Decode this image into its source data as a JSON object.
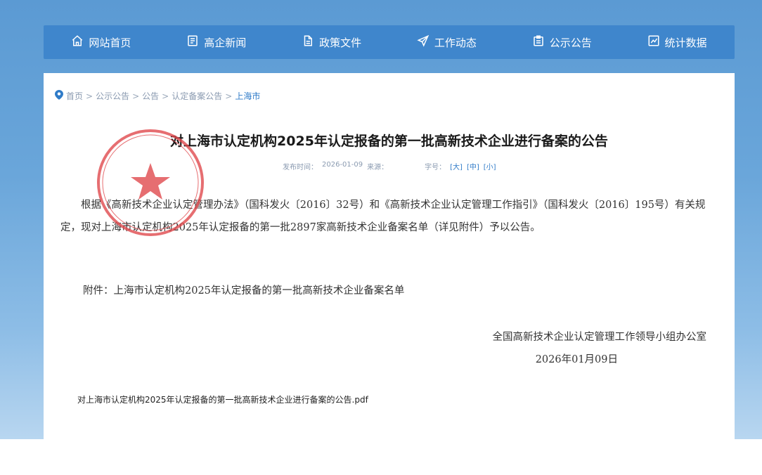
{
  "nav": {
    "items": [
      {
        "label": "网站首页",
        "icon": "home-icon"
      },
      {
        "label": "高企新闻",
        "icon": "news-icon"
      },
      {
        "label": "政策文件",
        "icon": "document-icon"
      },
      {
        "label": "工作动态",
        "icon": "send-icon"
      },
      {
        "label": "公示公告",
        "icon": "notice-icon"
      },
      {
        "label": "统计数据",
        "icon": "chart-icon"
      }
    ]
  },
  "breadcrumb": {
    "items": [
      "首页",
      "公示公告",
      "公告",
      "认定备案公告"
    ],
    "current": "上海市",
    "separator": ">"
  },
  "article": {
    "title": "对上海市认定机构2025年认定报备的第一批高新技术企业进行备案的公告",
    "meta": {
      "publish_label": "发布时间：",
      "publish_date": "2026-01-09",
      "source_label": "来源：",
      "font_label": "字号：",
      "font_sizes": [
        "[大]",
        "[中]",
        "[小]"
      ]
    },
    "body": "根据《高新技术企业认定管理办法》（国科发火〔2016〕32号）和《高新技术企业认定管理工作指引》（国科发火〔2016〕195号）有关规定，现对上海市认定机构2025年认定报备的第一批2897家高新技术企业备案名单（详见附件）予以公告。",
    "attachment": "附件：上海市认定机构2025年认定报备的第一批高新技术企业备案名单",
    "signer": "全国高新技术企业认定管理工作领导小组办公室",
    "sign_date": "2026年01月09日",
    "pdf": "对上海市认定机构2025年认定报备的第一批高新技术企业进行备案的公告.pdf"
  },
  "seal": {
    "color": "#e0464a",
    "icon": "red-seal-stamp"
  },
  "colors": {
    "nav_bg": "#3f86cc",
    "page_bg": "#6aa6da",
    "link": "#2f7bc8"
  }
}
